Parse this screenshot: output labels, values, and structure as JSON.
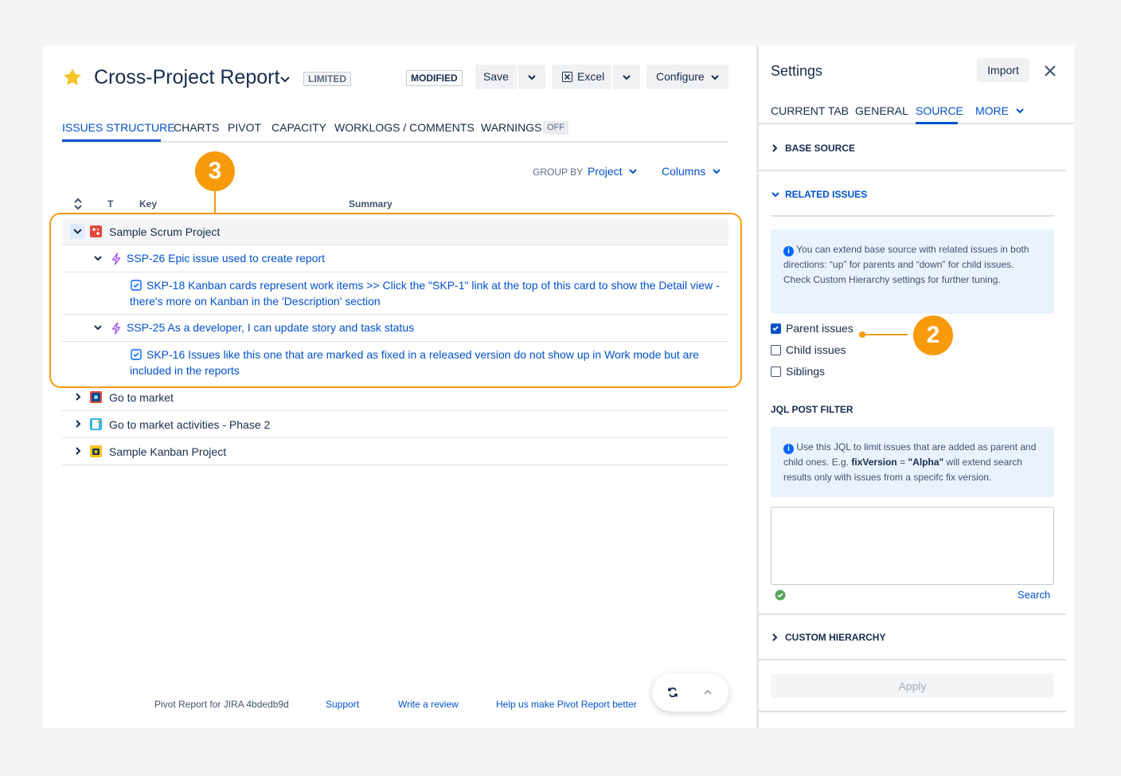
{
  "header": {
    "title": "Cross-Project Report",
    "limited_badge": "LIMITED",
    "modified_badge": "MODIFIED",
    "save_label": "Save",
    "excel_label": "Excel",
    "configure_label": "Configure"
  },
  "tabs": {
    "issues_structure": "ISSUES STRUCTURE",
    "charts": "CHARTS",
    "pivot": "PIVOT",
    "capacity": "CAPACITY",
    "worklogs": "WORKLOGS / COMMENTS",
    "warnings": "WARNINGS",
    "warnings_badge": "OFF"
  },
  "toolbar": {
    "group_by_label": "GROUP BY",
    "group_by_value": "Project",
    "columns_label": "Columns"
  },
  "table": {
    "col_type": "T",
    "col_key": "Key",
    "col_summary": "Summary",
    "rows": [
      {
        "text": "Sample Scrum Project"
      },
      {
        "text": "SSP-26 Epic issue used to create report"
      },
      {
        "line1": "SKP-18 Kanban cards represent work items >> Click the \"SKP-1\" link at the top of this card to show the Detail view -",
        "line2": "there's more on Kanban in the 'Description' section"
      },
      {
        "text": "SSP-25 As a developer, I can update story and task status"
      },
      {
        "line1": "SKP-16 Issues like this one that are marked as fixed in a released version do not show up in Work mode but are",
        "line2": "included in the reports"
      },
      {
        "text": "Go to market"
      },
      {
        "text": "Go to market activities - Phase 2"
      },
      {
        "text": "Sample Kanban Project"
      }
    ]
  },
  "callouts": {
    "three": "3",
    "two": "2"
  },
  "footer": {
    "version": "Pivot Report for JIRA 4bdedb9d",
    "support": "Support",
    "review": "Write a review",
    "help": "Help us make Pivot Report better"
  },
  "settings": {
    "title": "Settings",
    "import_label": "Import",
    "tabs": {
      "current_tab": "CURRENT TAB",
      "general": "GENERAL",
      "source": "SOURCE",
      "more": "MORE"
    },
    "base_source": "BASE SOURCE",
    "related_issues": "RELATED ISSUES",
    "related_info": "You can extend base source with related issues in both directions: “up” for parents and “down” for child issues. Check Custom Hierarchy settings for further tuning.",
    "parent_issues": "Parent issues",
    "child_issues": "Child issues",
    "siblings": "Siblings",
    "jql_post_filter": "JQL POST FILTER",
    "jql_info_a": "Use this JQL to limit issues that are added as parent and child ones. E.g.",
    "jql_info_field": "fixVersion",
    "jql_info_eq": "=",
    "jql_info_value": "\"Alpha\"",
    "jql_info_b": "will extend search results only with issues from a specifc fix version.",
    "search_label": "Search",
    "custom_hierarchy": "CUSTOM HIERARCHY",
    "apply_label": "Apply"
  },
  "colors": {
    "accent": "#0052cc",
    "callout": "#f79a0c",
    "star": "#f7c325"
  }
}
